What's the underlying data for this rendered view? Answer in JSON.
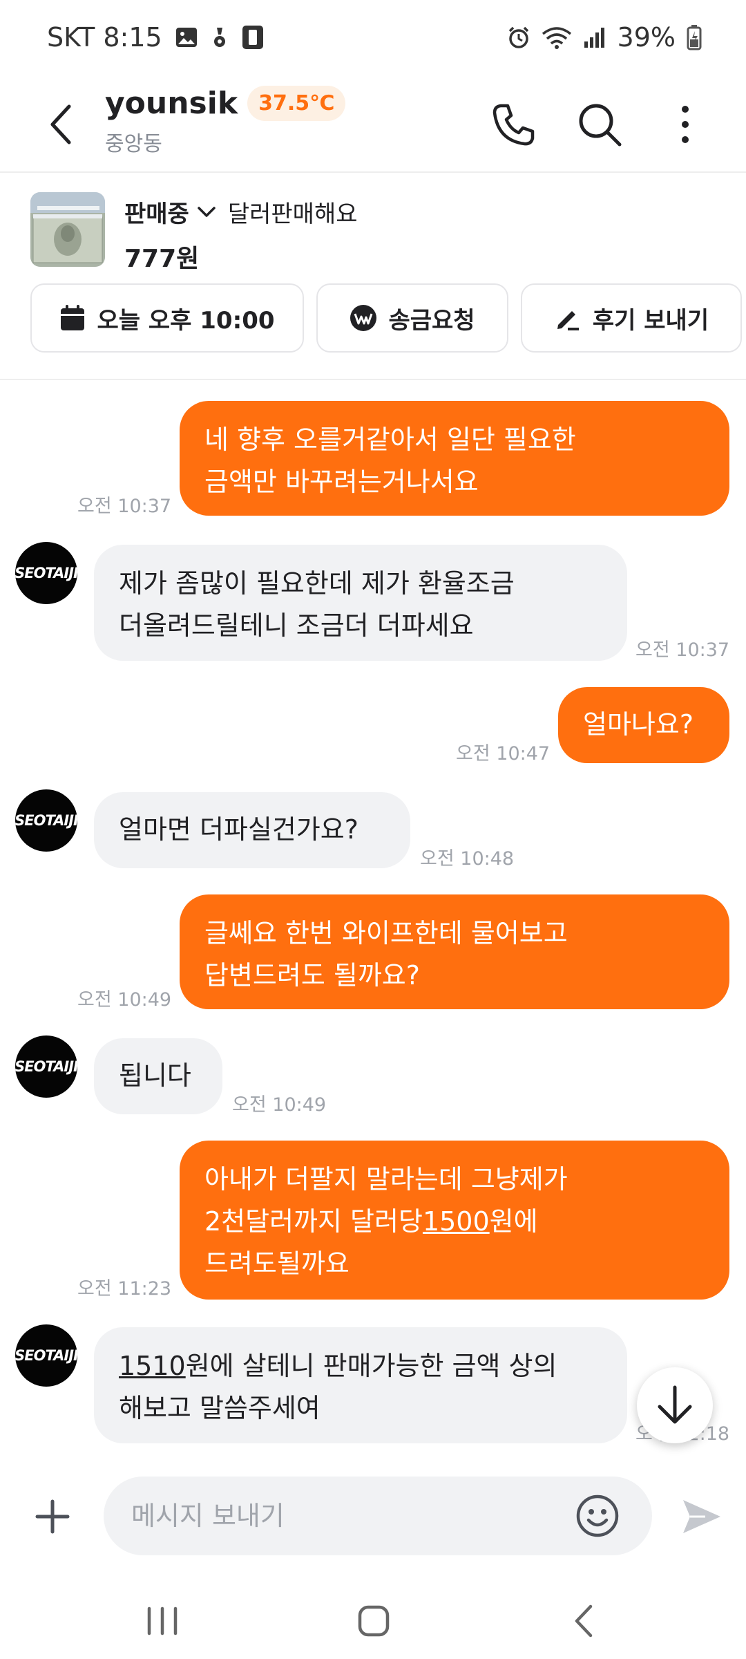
{
  "status_bar": {
    "carrier_time": "SKT 8:15",
    "battery": "39%"
  },
  "header": {
    "username": "younsik",
    "manner_temp": "37.5℃",
    "location": "중앙동"
  },
  "product": {
    "status": "판매중",
    "title": "달러판매해요",
    "price": "777원"
  },
  "actions": {
    "schedule_label": "오늘 오후 10:00",
    "transfer_label": "송금요청",
    "review_label": "후기 보내기"
  },
  "messages": [
    {
      "from": "me",
      "lines": [
        "네 향후 오를거같아서 일단 필요한",
        "금액만 바꾸려는거나서요"
      ],
      "time": "오전 10:37"
    },
    {
      "from": "them",
      "lines": [
        "제가 좀많이 필요한데 제가 환율조금",
        "더올려드릴테니 조금더 더파세요"
      ],
      "time": "오전 10:37"
    },
    {
      "from": "me",
      "lines": [
        "얼마나요?"
      ],
      "time": "오전 10:47"
    },
    {
      "from": "them",
      "lines": [
        "얼마면 더파실건가요?"
      ],
      "time": "오전 10:48"
    },
    {
      "from": "me",
      "lines": [
        "글쎄요 한번 와이프한테 물어보고",
        "답변드려도 될까요?"
      ],
      "time": "오전 10:49"
    },
    {
      "from": "them",
      "lines": [
        "됩니다"
      ],
      "time": "오전 10:49"
    },
    {
      "from": "me",
      "lines": [
        "아내가 더팔지 말라는데 그냥제가",
        "2천달러까지 달러당",
        "1500",
        "원에",
        "드려도될까요"
      ],
      "time": "오전 11:23"
    },
    {
      "from": "them",
      "lines": [
        "1510",
        "원에 살테니 판매가능한 금액 상의",
        "해보고 말씀주세여"
      ],
      "time": "오후 12:18"
    }
  ],
  "avatar_text": "SEOTAIJI",
  "input": {
    "placeholder": "메시지 보내기"
  },
  "colors": {
    "accent": "#ff6f0f",
    "bubble_them": "#f1f2f4",
    "temp_bg": "#fdf0e3"
  },
  "icons": [
    "back-arrow-icon",
    "phone-icon",
    "search-icon",
    "more-vertical-icon",
    "calendar-icon",
    "won-pay-icon",
    "pencil-icon",
    "plus-icon",
    "emoji-icon",
    "send-icon",
    "arrow-down-icon"
  ]
}
